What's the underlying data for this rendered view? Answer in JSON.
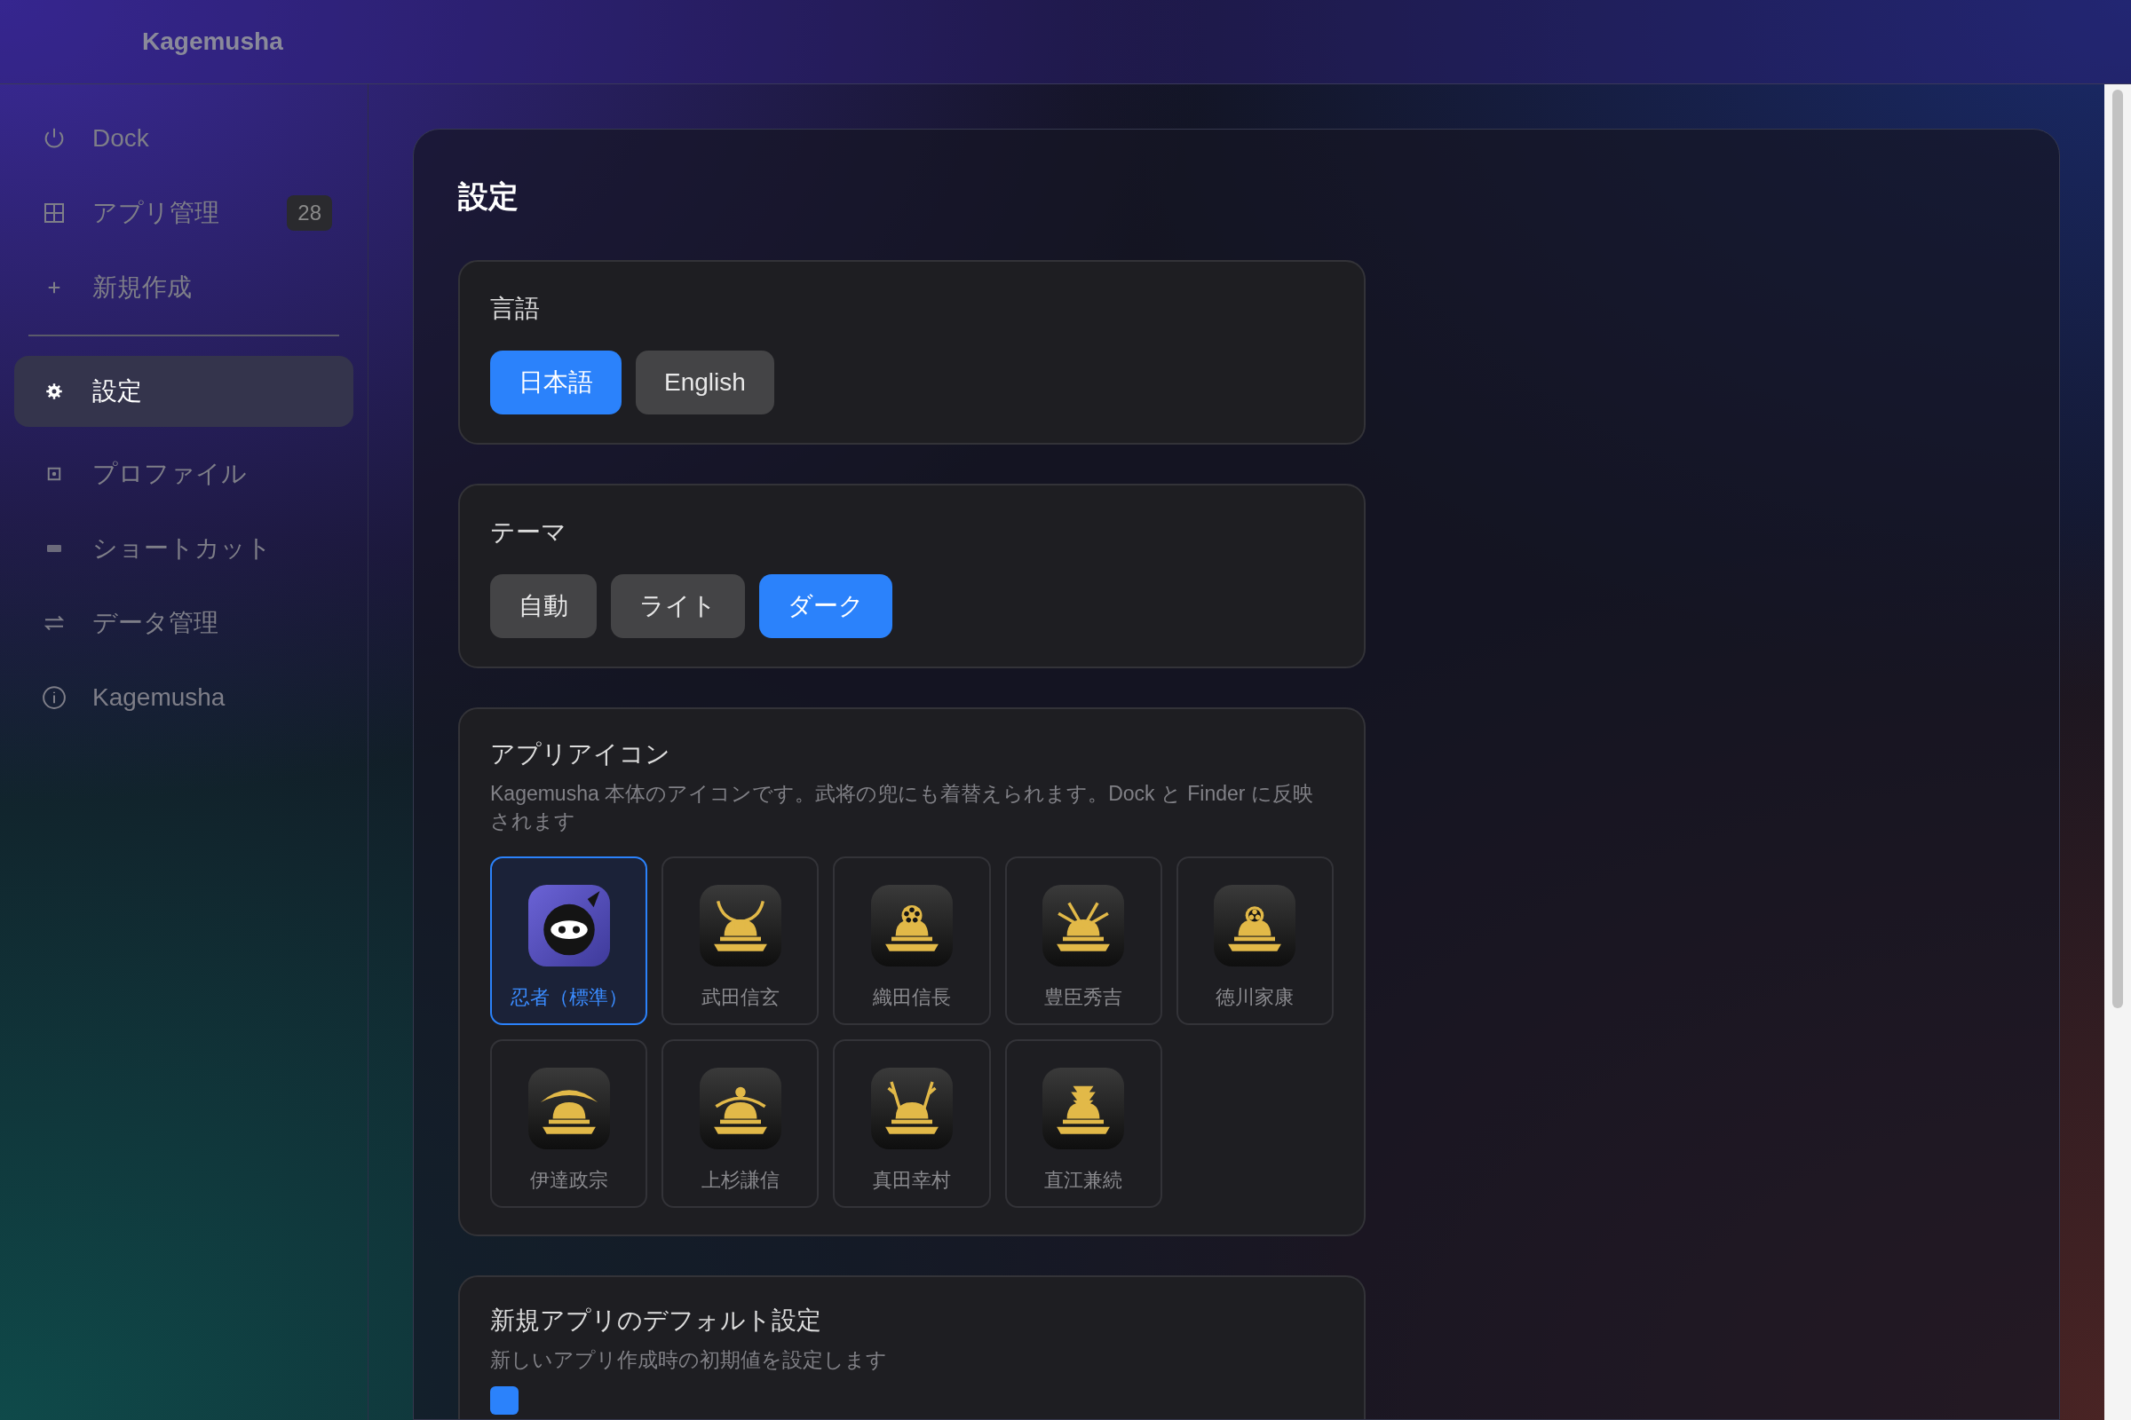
{
  "app": {
    "title": "Kagemusha"
  },
  "sidebar": {
    "items": [
      {
        "kind": "power",
        "label": "Dock",
        "selected": false
      },
      {
        "kind": "grid",
        "label": "アプリ管理",
        "badge": "28",
        "selected": false
      },
      {
        "kind": "plus",
        "label": "新規作成",
        "selected": false
      },
      {
        "kind": "gear",
        "label": "設定",
        "selected": true
      },
      {
        "kind": "square",
        "label": "プロファイル",
        "selected": false
      },
      {
        "kind": "keyboard",
        "label": "ショートカット",
        "selected": false
      },
      {
        "kind": "arrows",
        "label": "データ管理",
        "selected": false
      },
      {
        "kind": "info",
        "label": "Kagemusha",
        "selected": false
      }
    ]
  },
  "page": {
    "title": "設定"
  },
  "language": {
    "title": "言語",
    "options": [
      {
        "label": "日本語",
        "selected": true
      },
      {
        "label": "English",
        "selected": false
      }
    ]
  },
  "theme": {
    "title": "テーマ",
    "options": [
      {
        "label": "自動",
        "selected": false
      },
      {
        "label": "ライト",
        "selected": false
      },
      {
        "label": "ダーク",
        "selected": true
      }
    ]
  },
  "app_icon": {
    "title": "アプリアイコン",
    "description": "Kagemusha 本体のアイコンです。武将の兜にも着替えられます。Dock と Finder に反映されます",
    "options": [
      {
        "kind": "ninja",
        "label": "忍者（標準）",
        "selected": true
      },
      {
        "kind": "horns",
        "label": "武田信玄",
        "selected": false
      },
      {
        "kind": "wheel",
        "label": "織田信長",
        "selected": false
      },
      {
        "kind": "rays",
        "label": "豊臣秀吉",
        "selected": false
      },
      {
        "kind": "trefoil",
        "label": "徳川家康",
        "selected": false
      },
      {
        "kind": "crescent",
        "label": "伊達政宗",
        "selected": false
      },
      {
        "kind": "arc",
        "label": "上杉謙信",
        "selected": false
      },
      {
        "kind": "antlers",
        "label": "真田幸村",
        "selected": false
      },
      {
        "kind": "crest",
        "label": "直江兼続",
        "selected": false
      }
    ]
  },
  "defaults": {
    "title": "新規アプリのデフォルト設定",
    "description": "新しいアプリ作成時の初期値を設定します",
    "checkbox": {
      "checked": true
    }
  }
}
